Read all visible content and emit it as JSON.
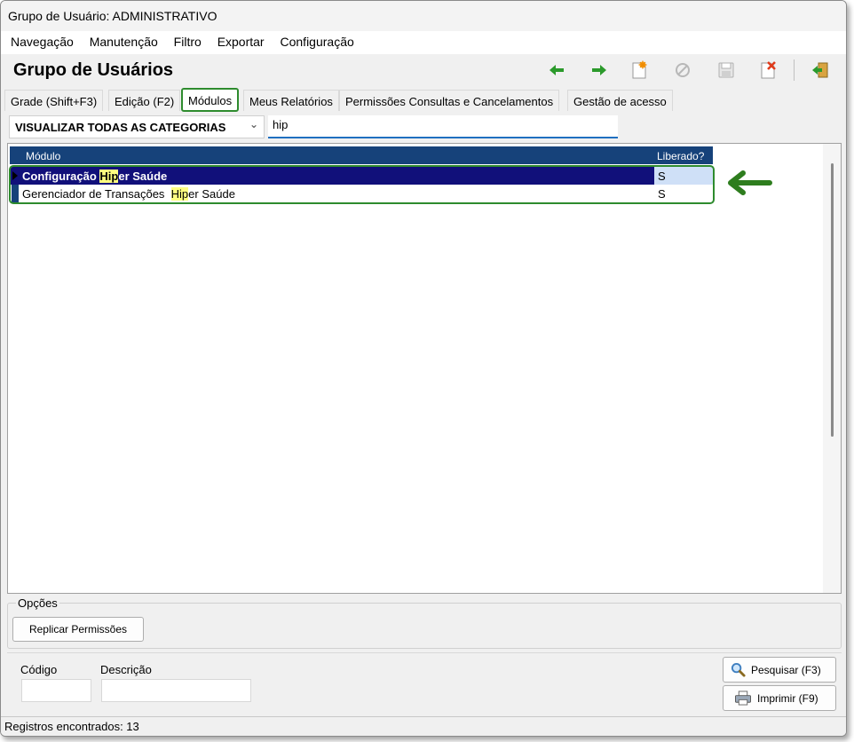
{
  "window": {
    "title": "Grupo de Usuário: ADMINISTRATIVO"
  },
  "menu": [
    "Navegação",
    "Manutenção",
    "Filtro",
    "Exportar",
    "Configuração"
  ],
  "header": {
    "title": "Grupo de Usuários"
  },
  "toolbar": {
    "icons": [
      "arrow-left-icon",
      "arrow-right-icon",
      "new-document-icon",
      "cancel-icon",
      "save-icon",
      "delete-icon",
      "exit-icon"
    ]
  },
  "tabs": [
    {
      "label": "Grade (Shift+F3)",
      "active": false
    },
    {
      "label": "Edição (F2)",
      "active": false
    },
    {
      "label": "Módulos",
      "active": true
    },
    {
      "label": "Meus Relatórios",
      "active": false
    },
    {
      "label": "Permissões Consultas e Cancelamentos",
      "active": false
    },
    {
      "label": "Gestão de acesso",
      "active": false
    }
  ],
  "filter": {
    "category": "VISUALIZAR TODAS AS CATEGORIAS",
    "search_value": "hip"
  },
  "grid": {
    "columns": [
      "Módulo",
      "Liberado?"
    ],
    "rows": [
      {
        "module_prefix": "Configuração ",
        "module_highlight": "Hip",
        "module_suffix": "er Saúde",
        "liberado": "S",
        "selected": true
      },
      {
        "module_prefix": "Gerenciador de Transações  ",
        "module_highlight": "Hip",
        "module_suffix": "er Saúde",
        "liberado": "S",
        "selected": false
      }
    ]
  },
  "options": {
    "legend": "Opções",
    "replicate_button": "Replicar Permissões"
  },
  "bottom": {
    "code_label": "Código",
    "description_label": "Descrição",
    "code_value": "",
    "description_value": "",
    "search_button": "Pesquisar (F3)",
    "print_button": "Imprimir (F9)"
  },
  "status": {
    "text": "Registros encontrados: 13"
  },
  "colors": {
    "grid_header": "#16427a",
    "selected_row": "#11107a",
    "highlight": "#ffff80",
    "annotation_green": "#2e8b2e",
    "search_underline": "#1f6fc0"
  }
}
